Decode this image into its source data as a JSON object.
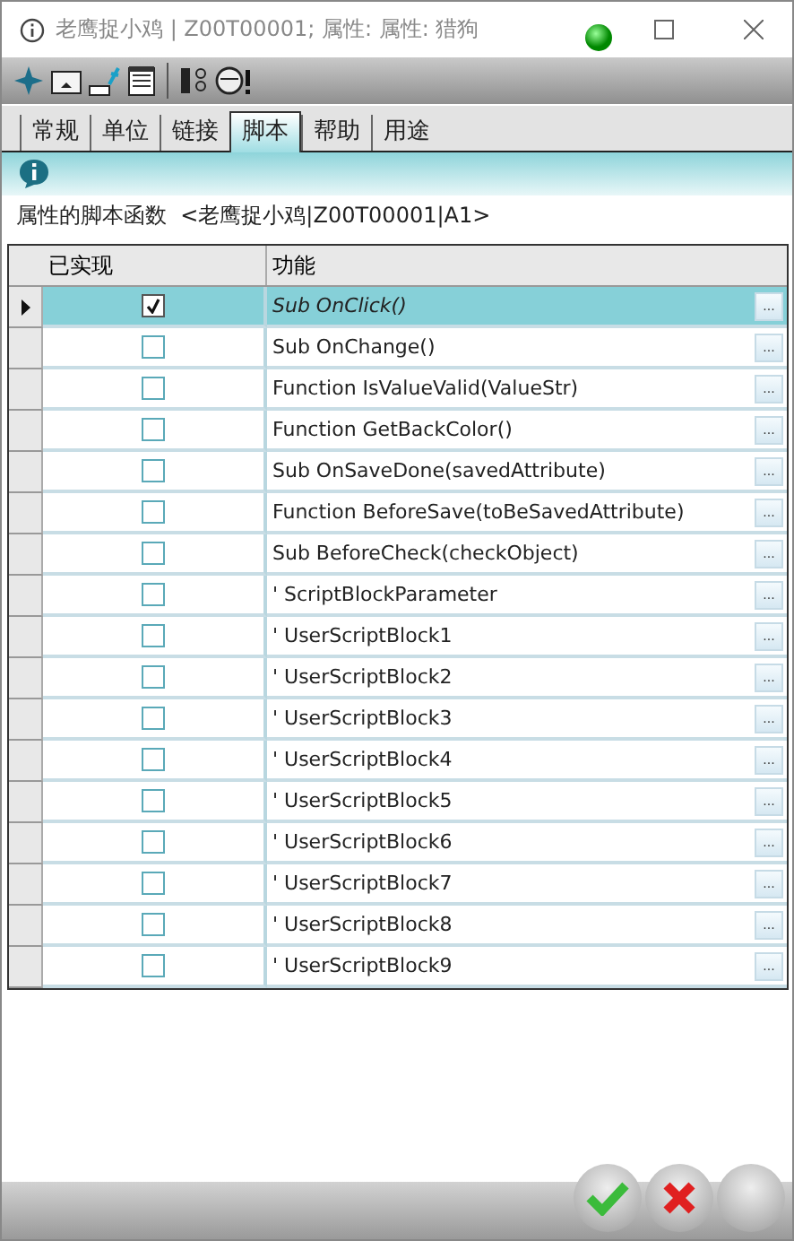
{
  "window": {
    "title": "老鹰捉小鸡 | Z00T00001; 属性:  属性: 猎狗"
  },
  "tabs": [
    {
      "label": "常规",
      "selected": false
    },
    {
      "label": "单位",
      "selected": false
    },
    {
      "label": "链接",
      "selected": false
    },
    {
      "label": "脚本",
      "selected": true
    },
    {
      "label": "帮助",
      "selected": false
    },
    {
      "label": "用途",
      "selected": false
    }
  ],
  "caption": "属性的脚本函数  <老鹰捉小鸡|Z00T00001|A1>",
  "table": {
    "columns": [
      "已实现",
      "功能"
    ],
    "rows": [
      {
        "implemented": true,
        "selected": true,
        "function": "Sub OnClick()",
        "button": "..."
      },
      {
        "implemented": false,
        "selected": false,
        "function": "Sub OnChange()",
        "button": "..."
      },
      {
        "implemented": false,
        "selected": false,
        "function": "Function IsValueValid(ValueStr)",
        "button": "..."
      },
      {
        "implemented": false,
        "selected": false,
        "function": "Function GetBackColor()",
        "button": "..."
      },
      {
        "implemented": false,
        "selected": false,
        "function": "Sub OnSaveDone(savedAttribute)",
        "button": "..."
      },
      {
        "implemented": false,
        "selected": false,
        "function": "Function BeforeSave(toBeSavedAttribute)",
        "button": "..."
      },
      {
        "implemented": false,
        "selected": false,
        "function": "Sub BeforeCheck(checkObject)",
        "button": "..."
      },
      {
        "implemented": false,
        "selected": false,
        "function": "' ScriptBlockParameter",
        "button": "..."
      },
      {
        "implemented": false,
        "selected": false,
        "function": "' UserScriptBlock1",
        "button": "..."
      },
      {
        "implemented": false,
        "selected": false,
        "function": "' UserScriptBlock2",
        "button": "..."
      },
      {
        "implemented": false,
        "selected": false,
        "function": "' UserScriptBlock3",
        "button": "..."
      },
      {
        "implemented": false,
        "selected": false,
        "function": "' UserScriptBlock4",
        "button": "..."
      },
      {
        "implemented": false,
        "selected": false,
        "function": "' UserScriptBlock5",
        "button": "..."
      },
      {
        "implemented": false,
        "selected": false,
        "function": "' UserScriptBlock6",
        "button": "..."
      },
      {
        "implemented": false,
        "selected": false,
        "function": "' UserScriptBlock7",
        "button": "..."
      },
      {
        "implemented": false,
        "selected": false,
        "function": "' UserScriptBlock8",
        "button": "..."
      },
      {
        "implemented": false,
        "selected": false,
        "function": "' UserScriptBlock9",
        "button": "..."
      }
    ]
  }
}
